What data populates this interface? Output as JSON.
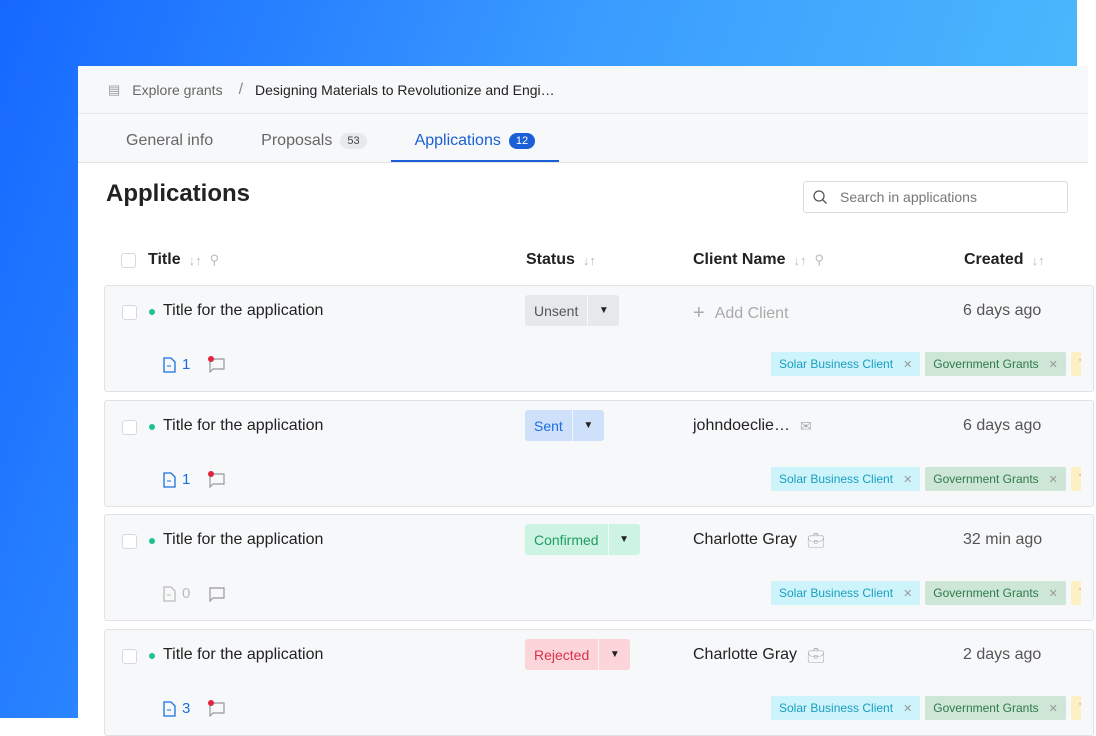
{
  "breadcrumb": {
    "root": "Explore grants",
    "current": "Designing Materials to Revolutionize and Engi…"
  },
  "tabs": [
    {
      "label": "General info"
    },
    {
      "label": "Proposals",
      "count": "53"
    },
    {
      "label": "Applications",
      "count": "12"
    }
  ],
  "page_title": "Applications",
  "search": {
    "placeholder": "Search in applications"
  },
  "columns": {
    "title": "Title",
    "status": "Status",
    "client": "Client Name",
    "created": "Created"
  },
  "rows": [
    {
      "title": "Title for the application",
      "status": "Unsent",
      "client": "Add Client",
      "created": "6 days ago",
      "docs": "1",
      "tags": [
        "Solar Business Client",
        "Government Grants",
        "Tag"
      ]
    },
    {
      "title": "Title for the application",
      "status": "Sent",
      "client": "johndoeclie…",
      "created": "6 days ago",
      "docs": "1",
      "tags": [
        "Solar Business Client",
        "Government Grants",
        "Tag"
      ]
    },
    {
      "title": "Title for the application",
      "status": "Confirmed",
      "client": "Charlotte Gray",
      "created": "32 min ago",
      "docs": "0",
      "tags": [
        "Solar Business Client",
        "Government Grants",
        "Tag"
      ]
    },
    {
      "title": "Title for the application",
      "status": "Rejected",
      "client": "Charlotte Gray",
      "created": "2 days ago",
      "docs": "3",
      "tags": [
        "Solar Business Client",
        "Government Grants",
        "Tag"
      ]
    }
  ],
  "colors": {
    "accent": "#1a5fd6",
    "unsent": "#e6e8eb",
    "sent": "#cfe0fb",
    "confirmed": "#cdf3e2",
    "rejected": "#fbd5d9"
  }
}
